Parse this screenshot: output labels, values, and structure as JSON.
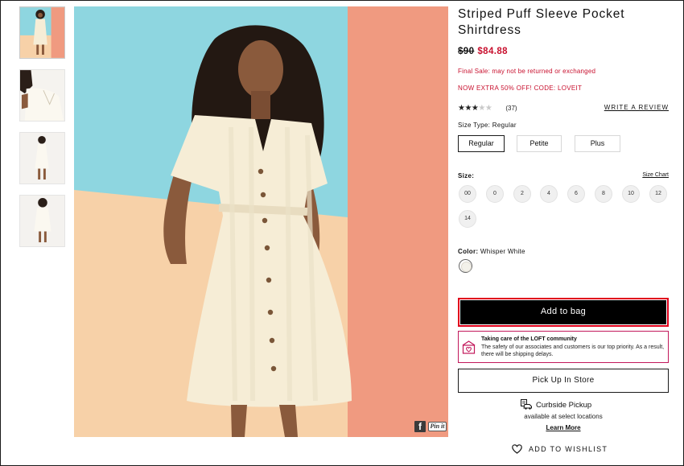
{
  "product": {
    "title": "Striped Puff Sleeve Pocket Shirtdress",
    "price_original": "$90",
    "price_sale": "$84.88",
    "final_sale_note": "Final Sale: may not be returned or exchanged",
    "promo": "NOW EXTRA 50% OFF! CODE: LOVEIT",
    "rating": {
      "stars_filled": 3,
      "stars_total": 5,
      "count_label": "(37)"
    },
    "write_review_label": "WRITE A REVIEW"
  },
  "size_type": {
    "label": "Size Type:",
    "selected": "Regular",
    "options": [
      "Regular",
      "Petite",
      "Plus"
    ]
  },
  "size": {
    "label": "Size:",
    "chart_link": "Size Chart",
    "options": [
      "00",
      "0",
      "2",
      "4",
      "6",
      "8",
      "10",
      "12",
      "14"
    ]
  },
  "color": {
    "label": "Color:",
    "selected": "Whisper White",
    "swatch_hex": "#f3f1ea"
  },
  "actions": {
    "add_to_bag": "Add to bag",
    "pick_up": "Pick Up In Store",
    "add_to_wishlist": "ADD TO WISHLIST"
  },
  "community_notice": {
    "title": "Taking care of the LOFT community",
    "text": "The safety of our associates and customers is our top priority. As a result, there will be shipping delays."
  },
  "curbside": {
    "title": "Curbside Pickup",
    "subtitle": "available at select locations",
    "learn_more": "Learn More"
  },
  "share": {
    "facebook_glyph": "f",
    "pinterest_label": "Pin it"
  },
  "colors": {
    "sale_red": "#c8102e",
    "highlight_border": "#e0001b",
    "notice_border": "#c2185b",
    "backdrop_blue": "#8ed6e0",
    "backdrop_peach": "#f7d1a8",
    "backdrop_salmon": "#f09a80"
  }
}
